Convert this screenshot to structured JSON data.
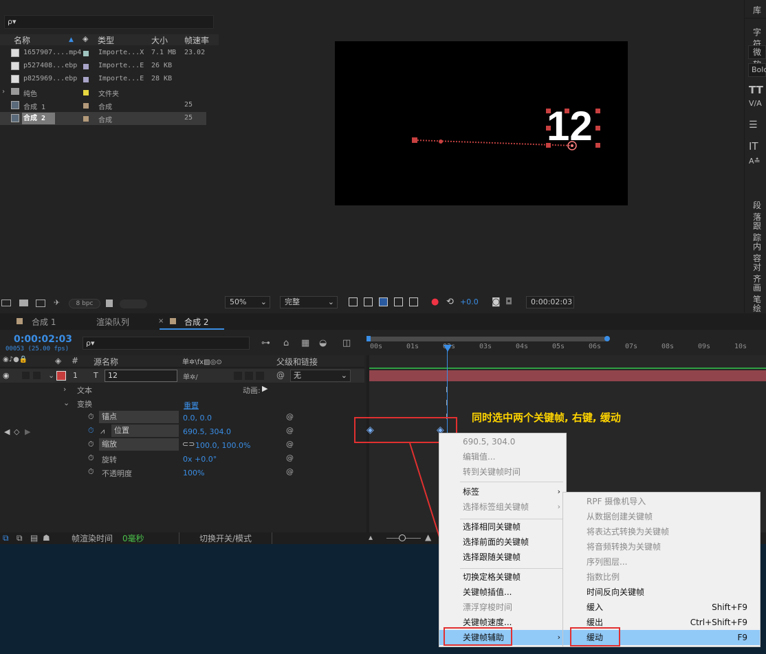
{
  "project": {
    "search_placeholder": "ρ▾",
    "columns": {
      "name": "名称",
      "type": "类型",
      "size": "大小",
      "fps": "帧速率"
    },
    "items": [
      {
        "name": "1657907....mp4",
        "type": "Importe...X",
        "size": "7.1 MB",
        "fps": "23.02",
        "swatch": "#9fc4c0"
      },
      {
        "name": "p527408...ebp",
        "type": "Importe...E",
        "size": "26 KB",
        "fps": "",
        "swatch": "#a8a4c8"
      },
      {
        "name": "p825969...ebp",
        "type": "Importe...E",
        "size": "28 KB",
        "fps": "",
        "swatch": "#a8a4c8"
      },
      {
        "name": "纯色",
        "type": "文件夹",
        "size": "",
        "fps": "",
        "swatch": "#e6d640"
      },
      {
        "name": "合成 1",
        "type": "合成",
        "size": "",
        "fps": "25",
        "swatch": "#b39a7a"
      },
      {
        "name": "合成 2",
        "type": "合成",
        "size": "",
        "fps": "25",
        "swatch": "#b39a7a"
      }
    ],
    "footer_bpc": "8 bpc"
  },
  "viewer": {
    "canvas_text": "12",
    "zoom": "50%",
    "quality": "完整",
    "exposure": "+0.0",
    "timecode": "0:00:02:03"
  },
  "right_panel": {
    "items": [
      "库",
      "字符",
      "微软",
      "Bold",
      "段落",
      "跟踪",
      "内容",
      "对齐",
      "画笔",
      "绘画"
    ]
  },
  "timeline": {
    "tabs": [
      "合成 1",
      "渲染队列",
      "合成 2"
    ],
    "timecode": "0:00:02:03",
    "frame_info": "00053 (25.00 fps)",
    "search_placeholder": "ρ▾",
    "header": {
      "num": "#",
      "source": "源名称",
      "switches": "单✲\\fx▨◎⊙",
      "parent": "父级和链接"
    },
    "layer": {
      "num": "1",
      "type_icon": "T",
      "name": "12",
      "parent": "无"
    },
    "text_group": "文本",
    "animate_label": "动画:",
    "transform_group": "变换",
    "reset_label": "重置",
    "properties": [
      {
        "name": "锚点",
        "value": "0.0, 0.0"
      },
      {
        "name": "位置",
        "value": "690.5, 304.0"
      },
      {
        "name": "缩放",
        "value": "100.0, 100.0%"
      },
      {
        "name": "旋转",
        "value": "0x +0.0°"
      },
      {
        "name": "不透明度",
        "value": "100%"
      }
    ],
    "ruler_ticks": [
      "00s",
      "01s",
      "02s",
      "03s",
      "04s",
      "05s",
      "06s",
      "07s",
      "08s",
      "09s",
      "10s"
    ],
    "footer": {
      "render_time_label": "帧渲染时间",
      "render_time_value": "0毫秒",
      "toggle_label": "切换开关/模式"
    }
  },
  "annotation": "同时选中两个关键帧, 右键, 缓动",
  "context_menu": {
    "items": [
      {
        "label": "690.5, 304.0",
        "disabled": true
      },
      {
        "label": "编辑值...",
        "disabled": true
      },
      {
        "label": "转到关键帧时间",
        "disabled": true
      },
      {
        "label": "标签",
        "disabled": false,
        "submenu": true
      },
      {
        "label": "选择标签组关键帧",
        "disabled": true,
        "submenu": true
      },
      {
        "label": "选择相同关键帧",
        "disabled": false
      },
      {
        "label": "选择前面的关键帧",
        "disabled": false
      },
      {
        "label": "选择跟随关键帧",
        "disabled": false
      },
      {
        "label": "切换定格关键帧",
        "disabled": false
      },
      {
        "label": "关键帧插值...",
        "disabled": false
      },
      {
        "label": "漂浮穿梭时间",
        "disabled": true
      },
      {
        "label": "关键帧速度...",
        "disabled": false
      },
      {
        "label": "关键帧辅助",
        "disabled": false,
        "submenu": true,
        "highlighted": true
      }
    ]
  },
  "submenu": {
    "items": [
      {
        "label": "RPF 摄像机导入",
        "shortcut": "",
        "disabled": true
      },
      {
        "label": "从数据创建关键帧",
        "shortcut": "",
        "disabled": true
      },
      {
        "label": "将表达式转换为关键帧",
        "shortcut": "",
        "disabled": true
      },
      {
        "label": "将音频转换为关键帧",
        "shortcut": "",
        "disabled": true
      },
      {
        "label": "序列图层...",
        "shortcut": "",
        "disabled": true
      },
      {
        "label": "指数比例",
        "shortcut": "",
        "disabled": true
      },
      {
        "label": "时间反向关键帧",
        "shortcut": "",
        "disabled": false
      },
      {
        "label": "缓入",
        "shortcut": "Shift+F9",
        "disabled": false
      },
      {
        "label": "缓出",
        "shortcut": "Ctrl+Shift+F9",
        "disabled": false
      },
      {
        "label": "缓动",
        "shortcut": "F9",
        "disabled": false,
        "highlighted": true
      }
    ]
  },
  "colors": {
    "accent": "#3a8ee6",
    "highlight": "#91c9f7",
    "annotation": "#ffd400",
    "redbox": "#e23030",
    "layer_bar": "#b04a52"
  }
}
